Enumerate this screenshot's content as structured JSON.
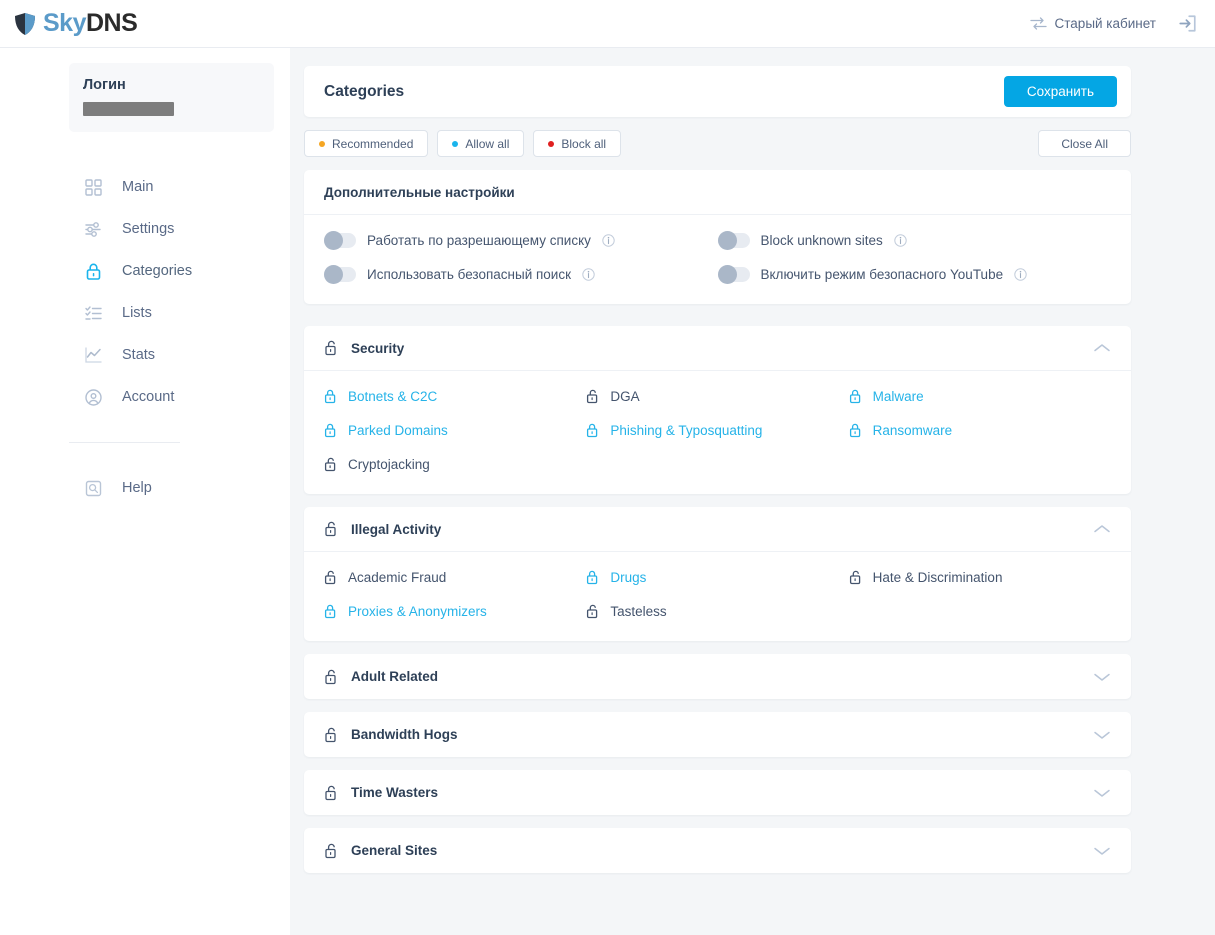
{
  "header": {
    "logo_sky": "Sky",
    "logo_dns": "DNS",
    "old_cabinet_label": "Старый кабинет",
    "swap_icon": "swap-arrows-icon",
    "logout_icon": "logout-icon"
  },
  "sidebar": {
    "user_label": "Логин",
    "items": [
      {
        "label": "Main",
        "icon": "grid-icon",
        "active": false
      },
      {
        "label": "Settings",
        "icon": "sliders-icon",
        "active": false
      },
      {
        "label": "Categories",
        "icon": "lock-icon",
        "active": true
      },
      {
        "label": "Lists",
        "icon": "checklist-icon",
        "active": false
      },
      {
        "label": "Stats",
        "icon": "chart-line-icon",
        "active": false
      },
      {
        "label": "Account",
        "icon": "user-circle-icon",
        "active": false
      }
    ],
    "help": {
      "label": "Help",
      "icon": "help-search-icon"
    }
  },
  "main": {
    "page_title": "Categories",
    "save_label": "Сохранить",
    "modes": [
      {
        "label": "Recommended",
        "color": "#f5a623"
      },
      {
        "label": "Allow all",
        "color": "#1ab4ec"
      },
      {
        "label": "Block all",
        "color": "#e02020"
      }
    ],
    "close_all_label": "Close All",
    "extra_settings": {
      "title": "Дополнительные настройки",
      "toggles": [
        {
          "label": "Работать по разрешающему списку",
          "on": false
        },
        {
          "label": "Block unknown sites",
          "on": false
        },
        {
          "label": "Использовать безопасный поиск",
          "on": false
        },
        {
          "label": "Включить режим безопасного YouTube",
          "on": false
        }
      ]
    },
    "sections": [
      {
        "title": "Security",
        "expanded": true,
        "items": [
          {
            "label": "Botnets & C2C",
            "state": "blocked"
          },
          {
            "label": "DGA",
            "state": "allowed"
          },
          {
            "label": "Malware",
            "state": "blocked"
          },
          {
            "label": "Parked Domains",
            "state": "blocked"
          },
          {
            "label": "Phishing & Typosquatting",
            "state": "blocked"
          },
          {
            "label": "Ransomware",
            "state": "blocked"
          },
          {
            "label": "Cryptojacking",
            "state": "allowed"
          }
        ]
      },
      {
        "title": "Illegal Activity",
        "expanded": true,
        "items": [
          {
            "label": "Academic Fraud",
            "state": "allowed"
          },
          {
            "label": "Drugs",
            "state": "blocked"
          },
          {
            "label": "Hate & Discrimination",
            "state": "allowed"
          },
          {
            "label": "Proxies & Anonymizers",
            "state": "blocked"
          },
          {
            "label": "Tasteless",
            "state": "allowed"
          }
        ]
      },
      {
        "title": "Adult Related",
        "expanded": false,
        "items": []
      },
      {
        "title": "Bandwidth Hogs",
        "expanded": false,
        "items": []
      },
      {
        "title": "Time Wasters",
        "expanded": false,
        "items": []
      },
      {
        "title": "General Sites",
        "expanded": false,
        "items": []
      }
    ]
  },
  "colors": {
    "accent": "#04a6e4",
    "blocked": "#26b3e8",
    "allowed": "#44546d",
    "title": "#2e4057",
    "page_bg": "#f4f6f8"
  }
}
